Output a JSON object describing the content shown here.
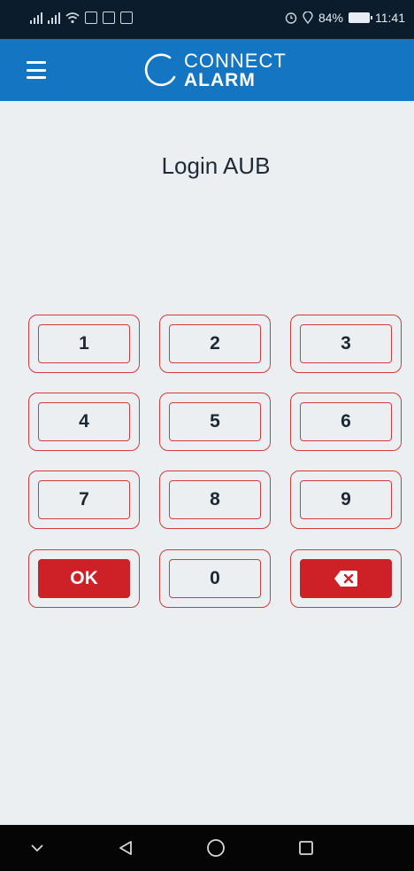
{
  "status_bar": {
    "battery_pct": "84%",
    "time": "11:41"
  },
  "app_bar": {
    "logo_line1": "CONNECT",
    "logo_line2": "ALARM"
  },
  "page": {
    "title": "Login AUB"
  },
  "keypad": {
    "keys": [
      "1",
      "2",
      "3",
      "4",
      "5",
      "6",
      "7",
      "8",
      "9"
    ],
    "ok_label": "OK",
    "zero_label": "0",
    "delete_icon": "backspace-icon"
  },
  "colors": {
    "status_bar_bg": "#0b1d2c",
    "app_bar_bg": "#1476c2",
    "page_bg": "#eceff2",
    "key_border": "#d23b3b",
    "action_red": "#cd2127",
    "nav_bar_bg": "#050505"
  },
  "nav_bar": {
    "icons": [
      "chevron-down-icon",
      "back-icon",
      "home-icon",
      "recents-icon"
    ]
  }
}
